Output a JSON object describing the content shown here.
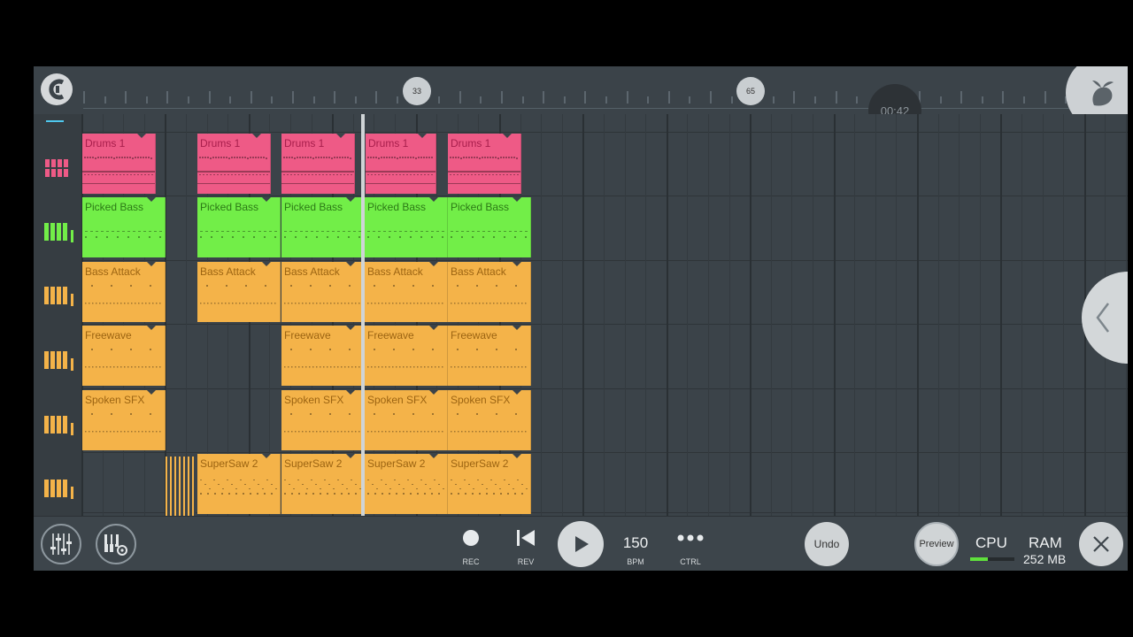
{
  "timeline": {
    "markers": [
      "33",
      "65"
    ],
    "time": "00:42"
  },
  "tracks": [
    {
      "icon": "drum-pads-icon",
      "clips": [
        {
          "name": "Drums 1"
        },
        {
          "name": "Drums 1"
        },
        {
          "name": "Drums 1"
        },
        {
          "name": "Drums 1"
        },
        {
          "name": "Drums 1"
        }
      ]
    },
    {
      "icon": "piano-keys-icon",
      "clips": [
        {
          "name": "Picked Bass"
        },
        {
          "name": "Picked Bass"
        },
        {
          "name": "Picked Bass"
        },
        {
          "name": "Picked Bass"
        },
        {
          "name": "Picked Bass"
        }
      ]
    },
    {
      "icon": "piano-keys-icon",
      "clips": [
        {
          "name": "Bass Attack"
        },
        {
          "name": "Bass Attack"
        },
        {
          "name": "Bass Attack"
        },
        {
          "name": "Bass Attack"
        },
        {
          "name": "Bass Attack"
        }
      ]
    },
    {
      "icon": "piano-keys-icon",
      "clips": [
        {
          "name": "Freewave"
        },
        {
          "name": "Freewave"
        },
        {
          "name": "Freewave"
        },
        {
          "name": "Freewave"
        }
      ]
    },
    {
      "icon": "piano-keys-icon",
      "clips": [
        {
          "name": "Spoken SFX"
        },
        {
          "name": "Spoken SFX"
        },
        {
          "name": "Spoken SFX"
        },
        {
          "name": "Spoken SFX"
        }
      ]
    },
    {
      "icon": "piano-keys-icon",
      "clips": [
        {
          "name": "SuperSaw 2"
        },
        {
          "name": "SuperSaw 2"
        },
        {
          "name": "SuperSaw 2"
        },
        {
          "name": "SuperSaw 2"
        }
      ]
    }
  ],
  "colors": {
    "drums": "#ee5a86",
    "bass": "#72ee48",
    "orange": "#f4b349",
    "background": "#3b4349"
  },
  "bottom_bar": {
    "rec_label": "REC",
    "rev_label": "REV",
    "bpm_value": "150",
    "bpm_label": "BPM",
    "ctrl_label": "CTRL",
    "undo_label": "Undo",
    "preview_label": "Preview",
    "cpu_label": "CPU",
    "cpu_level": 0.4,
    "ram_label": "RAM",
    "ram_value": "252 MB"
  }
}
